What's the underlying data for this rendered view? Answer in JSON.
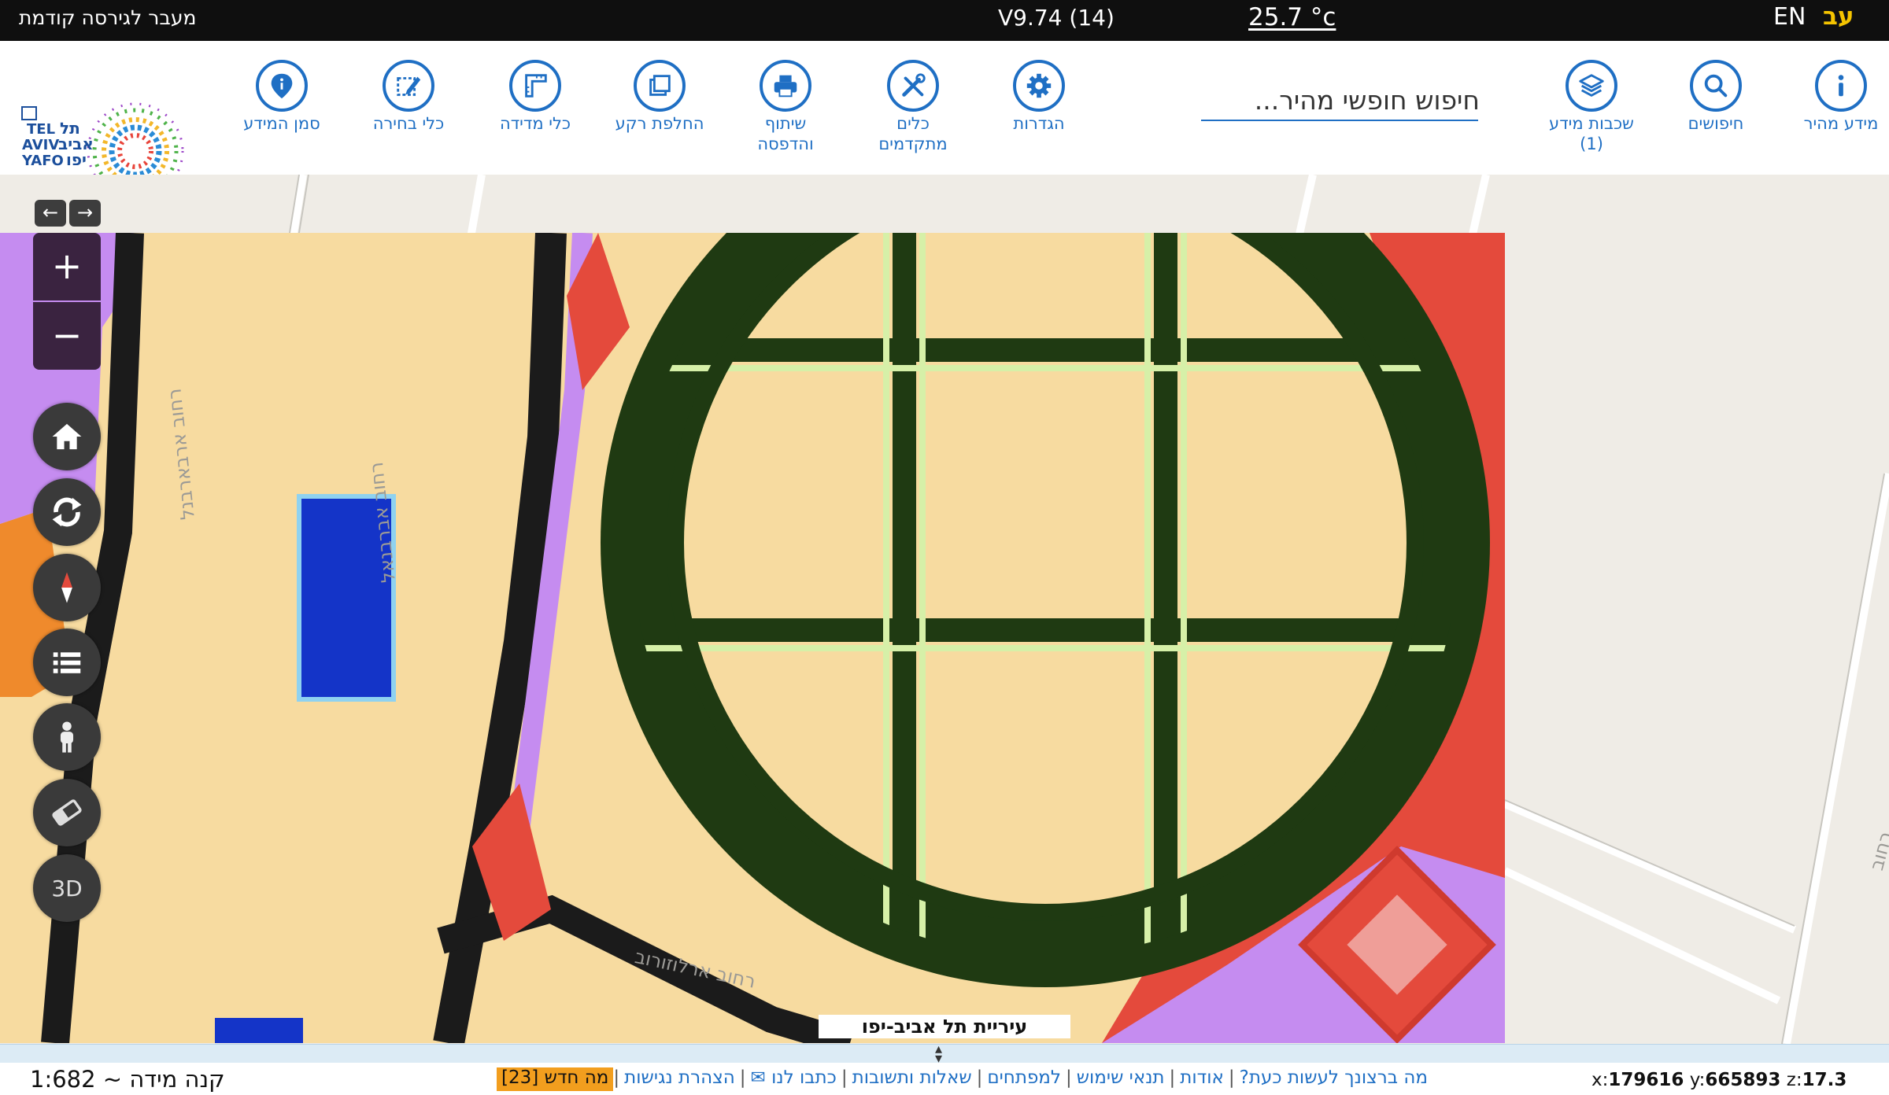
{
  "topbar": {
    "previous_version": "מעבר לגירסה קודמת",
    "version": "V9.74 (14)",
    "temperature": "25.7 °c",
    "lang_en": "EN",
    "lang_he": "עב"
  },
  "toolbar": {
    "search_placeholder": "חיפוש חופשי מהיר...",
    "items": [
      {
        "label": "מידע מהיר",
        "icon": "info-icon"
      },
      {
        "label": "חיפושים",
        "icon": "search-icon"
      },
      {
        "label": "שכבות מידע\n(1)",
        "icon": "layers-icon"
      },
      {
        "label": "הגדרות",
        "icon": "gear-icon"
      },
      {
        "label": "כלים\nמתקדמים",
        "icon": "tools-icon"
      },
      {
        "label": "שיתוף\nוהדפסה",
        "icon": "printer-icon"
      },
      {
        "label": "החלפת רקע",
        "icon": "switch-background-icon"
      },
      {
        "label": "כלי מדידה",
        "icon": "ruler-icon"
      },
      {
        "label": "כלי בחירה",
        "icon": "select-edit-icon"
      },
      {
        "label": "סמן המידע",
        "icon": "map-pin-icon"
      }
    ],
    "logo_text": {
      "en_line1": "TEL",
      "en_line2": "AVIV",
      "en_line3": "YAFO",
      "he_line1": "תל",
      "he_line2": "אביב",
      "he_line3": "יפו"
    }
  },
  "map": {
    "street_labels": [
      "רחוב ארבארבנל",
      "רחוב אברבנאל",
      "רחוב ארלוזורוב",
      "רחוב בן סרוק"
    ],
    "city_label": "עיריית תל אביב-יפו",
    "controls": {
      "back": "←",
      "forward": "→",
      "zoom_in": "+",
      "zoom_out": "−",
      "three_d": "3D"
    }
  },
  "footer": {
    "scale": "קנה מידה ~ 1:682",
    "links": [
      "מה ברצונך לעשות כעת?",
      "אודות",
      "תנאי שימוש",
      "למפתחים",
      "שאלות ותשובות",
      "כתבו לנו ✉",
      "הצהרת נגישות"
    ],
    "whats_new": "מה חדש [23]",
    "coords": {
      "x": "179616",
      "y": "665893",
      "z": "17.3",
      "x_label": "x:",
      "y_label": "y:",
      "z_label": "z:"
    }
  },
  "colors": {
    "accent": "#1f6fc4",
    "topbar_bg": "#0f0f0f",
    "lang_active": "#f5c400",
    "zone_sand": "#f7dba0",
    "zone_green": "#1f3a12",
    "zone_purple": "#c58cf0",
    "zone_red": "#e44a3c",
    "zone_blue": "#1434c8",
    "zone_orange": "#ef8a2c"
  }
}
